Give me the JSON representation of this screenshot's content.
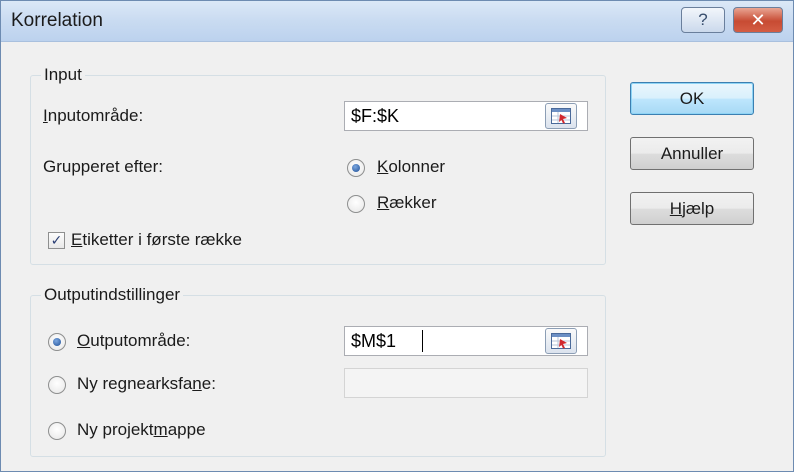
{
  "window": {
    "title": "Korrelation",
    "help_glyph": "?",
    "close_glyph": "✕"
  },
  "input_group": {
    "legend": "Input",
    "range_label_accel": "I",
    "range_label_rest": "nputområde:",
    "range_value": "$F:$K",
    "grouped_label": "Grupperet efter:",
    "columns_accel": "K",
    "columns_rest": "olonner",
    "rows_accel": "R",
    "rows_rest": "ækker",
    "labels_checkbox_accel": "E",
    "labels_checkbox_rest": "tiketter i første række",
    "labels_checked": true,
    "grouped_selection": "Kolonner"
  },
  "output_group": {
    "legend": "Outputindstillinger",
    "output_range_accel": "O",
    "output_range_rest": "utputområde:",
    "output_range_value": "$M$1",
    "new_sheet_pre": "Ny regnearksfa",
    "new_sheet_accel": "n",
    "new_sheet_post": "e:",
    "new_sheet_value": "",
    "new_workbook_pre": "Ny projekt",
    "new_workbook_accel": "m",
    "new_workbook_post": "appe",
    "selected": "Outputområde"
  },
  "buttons": {
    "ok": "OK",
    "cancel": "Annuller",
    "help_accel": "H",
    "help_rest": "jælp"
  },
  "icons": {
    "range_selector": "range-select-icon",
    "checkmark": "✓"
  }
}
